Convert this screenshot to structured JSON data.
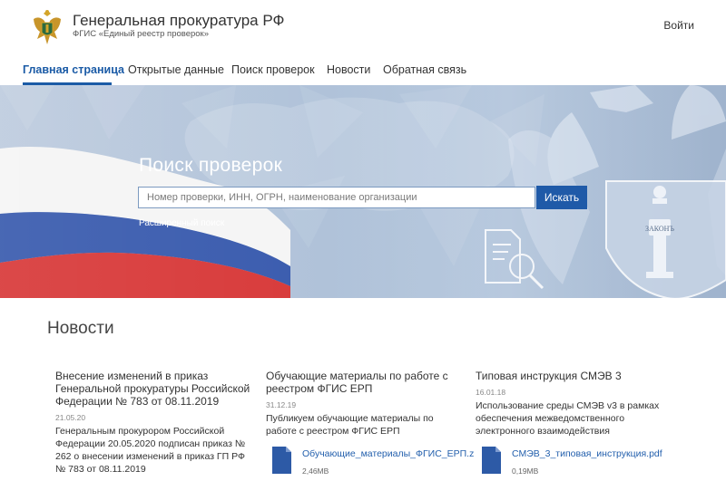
{
  "header": {
    "org_title": "Генеральная прокуратура РФ",
    "org_subtitle": "ФГИС «Единый реестр проверок»",
    "login_label": "Войти"
  },
  "nav": {
    "items": [
      {
        "label": "Главная страница",
        "active": true
      },
      {
        "label": "Открытые данные"
      },
      {
        "label": "Поиск проверок"
      },
      {
        "label": "Новости"
      },
      {
        "label": "Обратная связь"
      }
    ]
  },
  "hero": {
    "title": "Поиск проверок",
    "search_placeholder": "Номер проверки, ИНН, ОГРН, наименование организации",
    "search_button": "Искать",
    "advanced_link": "Расширенный поиск",
    "shield_text": "ЗАКОНЪ"
  },
  "news": {
    "heading": "Новости",
    "items": [
      {
        "title": "Внесение изменений в приказ Генеральной прокуратуры Российской Федерации № 783 от 08.11.2019",
        "date": "21.05.20",
        "body": "Генеральным прокурором Российской Федерации 20.05.2020 подписан приказ № 262 о внесении изменений в приказ ГП РФ № 783 от 08.11.2019"
      },
      {
        "title": "Обучающие материалы по работе с реестром ФГИС ЕРП",
        "date": "31.12.19",
        "body": "Публикуем обучающие материалы по работе с реестром ФГИС ЕРП",
        "file": {
          "name": "Обучающие_материалы_ФГИС_ЕРП.z",
          "size": "2,46MB"
        }
      },
      {
        "title": "Типовая инструкция СМЭВ 3",
        "date": "16.01.18",
        "body": "Использование среды СМЭВ v3 в рамках обеспечения межведомственного электронного взаимодействия",
        "file": {
          "name": "СМЭВ_3_типовая_инструкция.pdf",
          "size": "0,19MB"
        }
      }
    ]
  },
  "colors": {
    "accent": "#1b5ba6",
    "button": "#1f5aa8",
    "link": "#2460ad",
    "flag_white": "#f4f4f4",
    "flag_blue": "#2b4fa8",
    "flag_red": "#d52b2b"
  }
}
